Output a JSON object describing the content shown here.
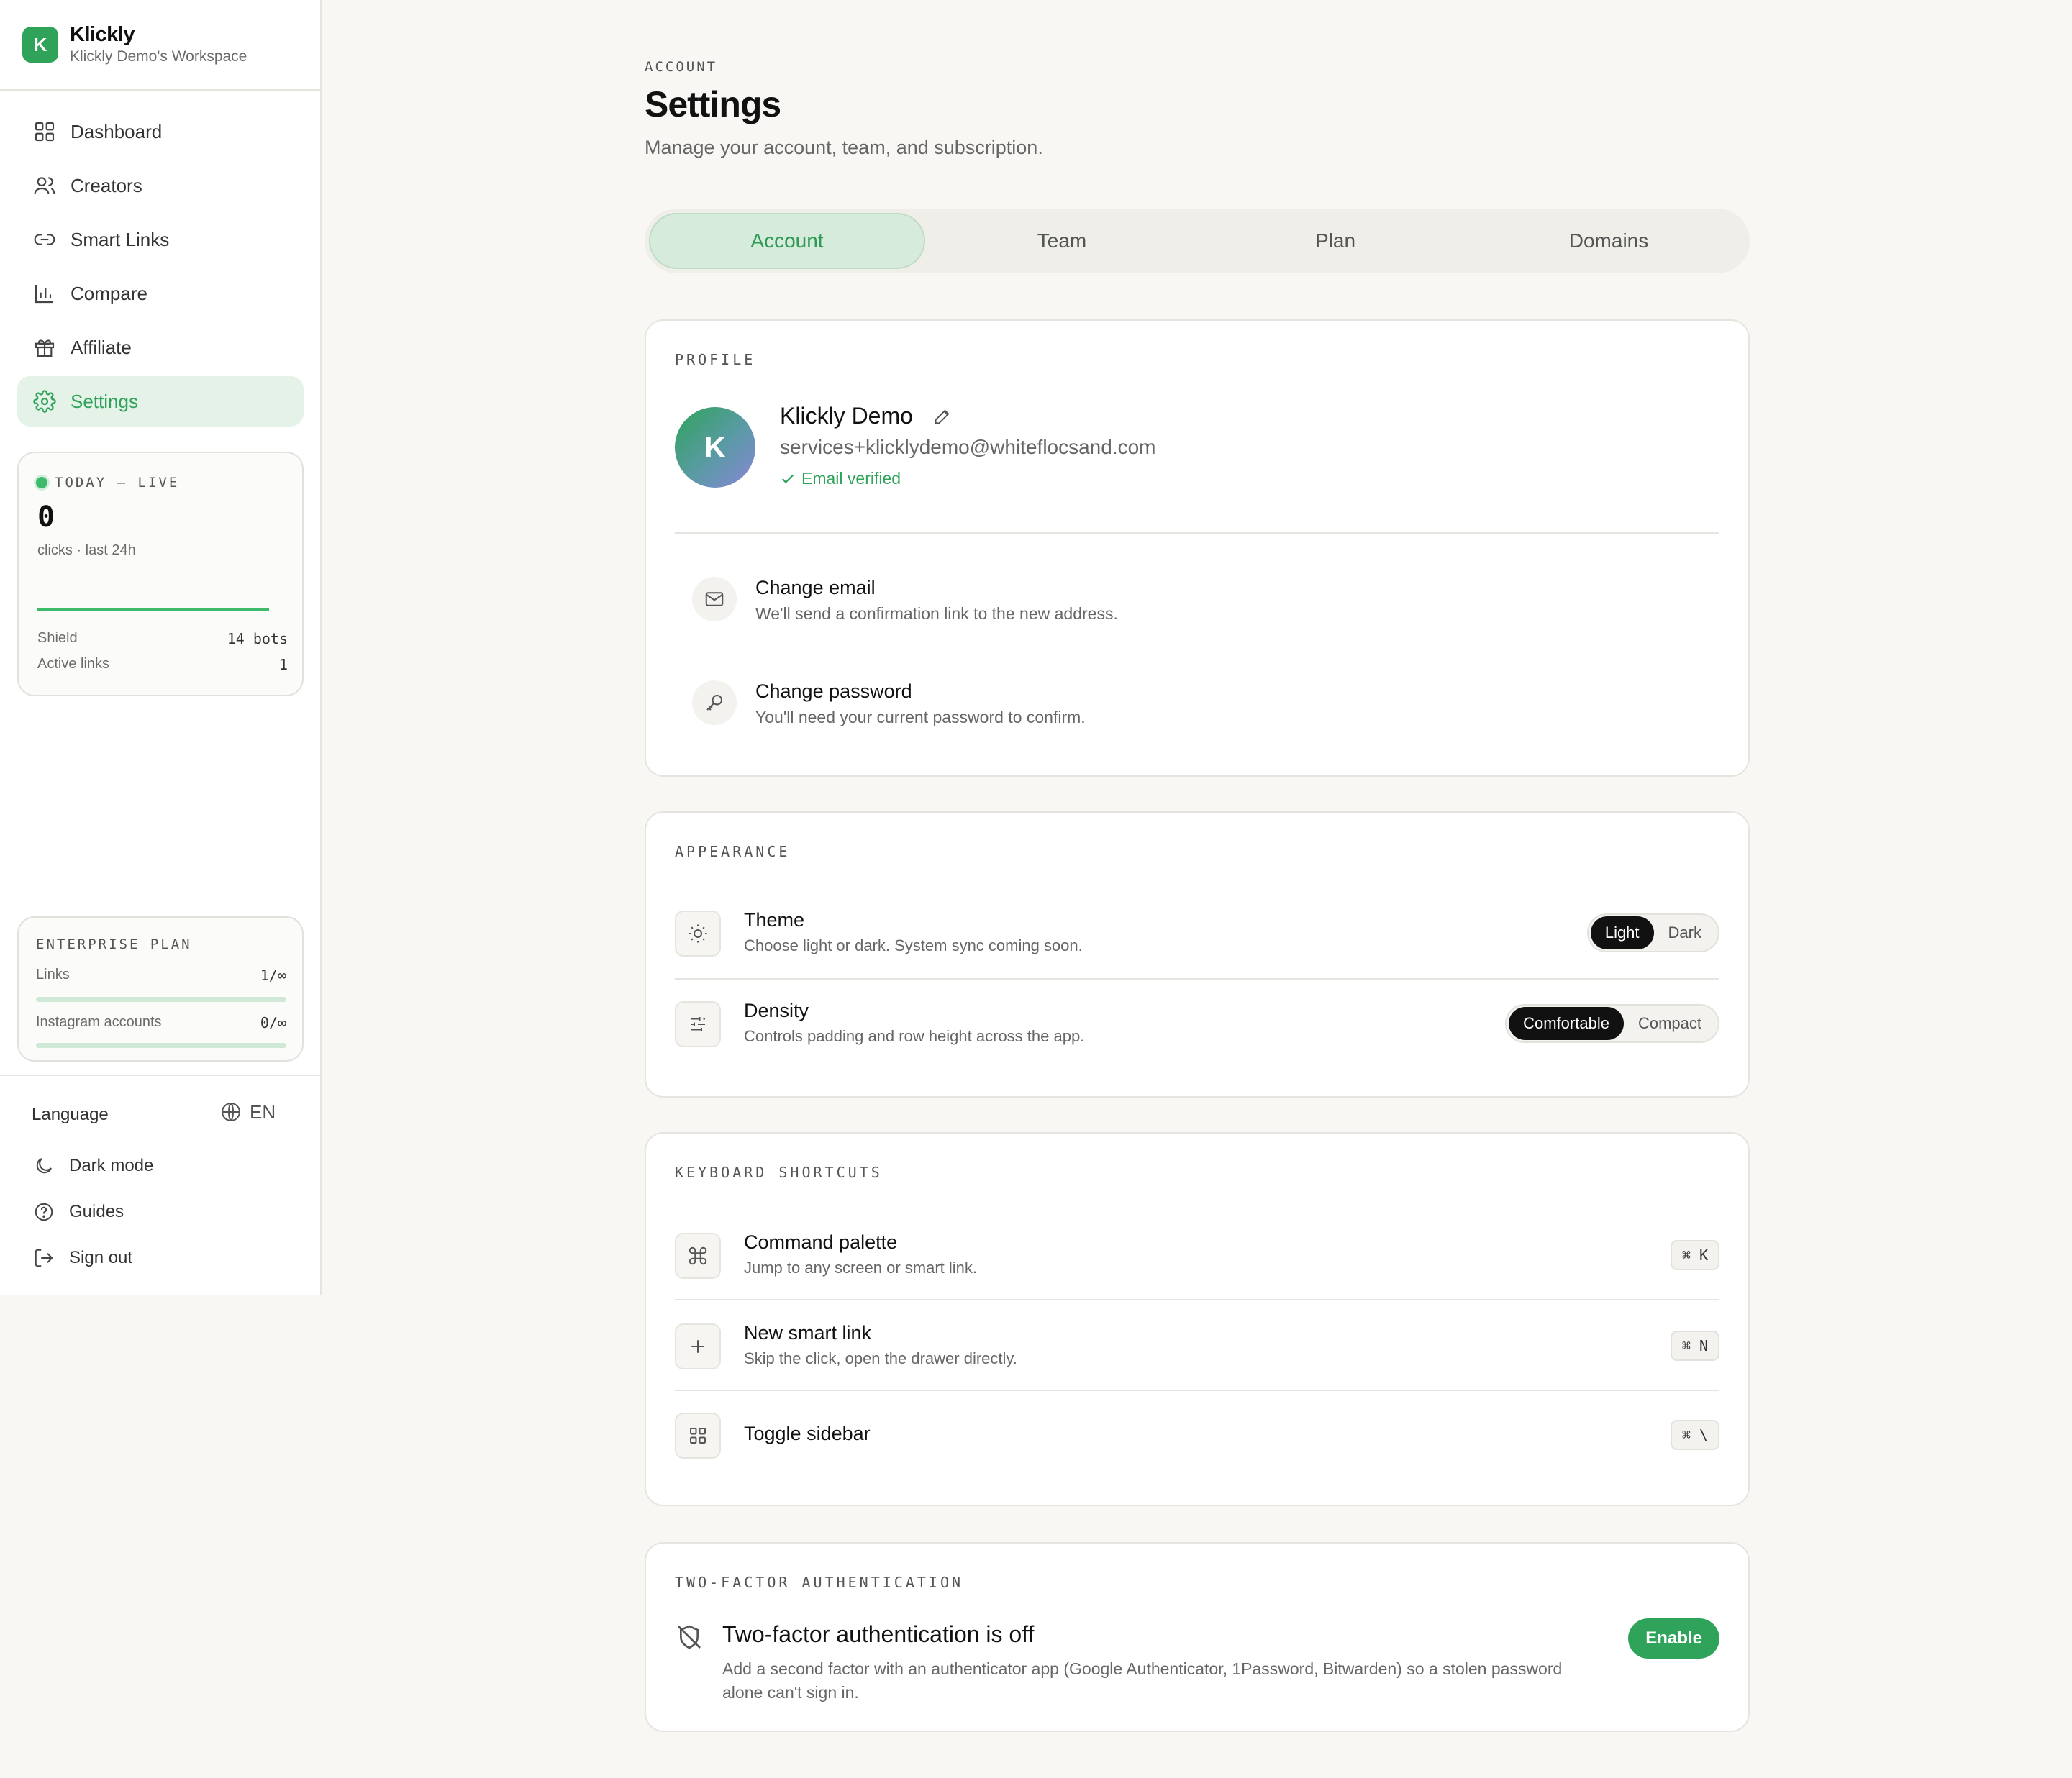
{
  "brand": {
    "logo_letter": "K",
    "name": "Klickly",
    "workspace": "Klickly Demo's Workspace"
  },
  "nav": [
    {
      "label": "Dashboard",
      "icon": "grid-icon"
    },
    {
      "label": "Creators",
      "icon": "users-icon"
    },
    {
      "label": "Smart Links",
      "icon": "link-icon"
    },
    {
      "label": "Compare",
      "icon": "bar-chart-icon"
    },
    {
      "label": "Affiliate",
      "icon": "gift-icon"
    },
    {
      "label": "Settings",
      "icon": "gear-icon",
      "active": true
    }
  ],
  "live": {
    "label": "TODAY — LIVE",
    "value": "0",
    "sub": "clicks · last 24h",
    "shield_label": "Shield",
    "shield_value": "14 bots",
    "active_label": "Active links",
    "active_value": "1"
  },
  "plan": {
    "title": "ENTERPRISE PLAN",
    "links_label": "Links",
    "links_value": "1/∞",
    "links_fill": 0.0,
    "ig_label": "Instagram accounts",
    "ig_value": "0/∞",
    "ig_fill": 0.0
  },
  "footer": {
    "language_label": "Language",
    "language_value": "EN",
    "dark_mode": "Dark mode",
    "guides": "Guides",
    "sign_out": "Sign out"
  },
  "page": {
    "eyebrow": "ACCOUNT",
    "title": "Settings",
    "subtitle": "Manage your account, team, and subscription."
  },
  "tabs": [
    {
      "label": "Account",
      "active": true
    },
    {
      "label": "Team"
    },
    {
      "label": "Plan"
    },
    {
      "label": "Domains"
    }
  ],
  "profile": {
    "section": "PROFILE",
    "avatar_letter": "K",
    "name": "Klickly Demo",
    "email": "services+klicklydemo@whiteflocsand.com",
    "verified": "Email verified",
    "change_email_title": "Change email",
    "change_email_sub": "We'll send a confirmation link to the new address.",
    "change_password_title": "Change password",
    "change_password_sub": "You'll need your current password to confirm."
  },
  "appearance": {
    "section": "APPEARANCE",
    "theme_title": "Theme",
    "theme_sub": "Choose light or dark. System sync coming soon.",
    "theme_options": [
      "Light",
      "Dark"
    ],
    "theme_selected": "Light",
    "density_title": "Density",
    "density_sub": "Controls padding and row height across the app.",
    "density_options": [
      "Comfortable",
      "Compact"
    ],
    "density_selected": "Comfortable"
  },
  "shortcuts": {
    "section": "KEYBOARD SHORTCUTS",
    "items": [
      {
        "title": "Command palette",
        "sub": "Jump to any screen or smart link.",
        "key": "⌘ K",
        "icon": "command-icon"
      },
      {
        "title": "New smart link",
        "sub": "Skip the click, open the drawer directly.",
        "key": "⌘ N",
        "icon": "plus-icon"
      },
      {
        "title": "Toggle sidebar",
        "sub": "",
        "key": "⌘ \\",
        "icon": "grid-icon"
      }
    ]
  },
  "twofa": {
    "section": "TWO-FACTOR AUTHENTICATION",
    "title": "Two-factor authentication is off",
    "sub": "Add a second factor with an authenticator app (Google Authenticator, 1Password, Bitwarden) so a stolen password alone can't sign in.",
    "button": "Enable"
  },
  "colors": {
    "accent": "#2fa35a",
    "accent_soft": "#e4f2e7",
    "background": "#f8f7f4"
  }
}
